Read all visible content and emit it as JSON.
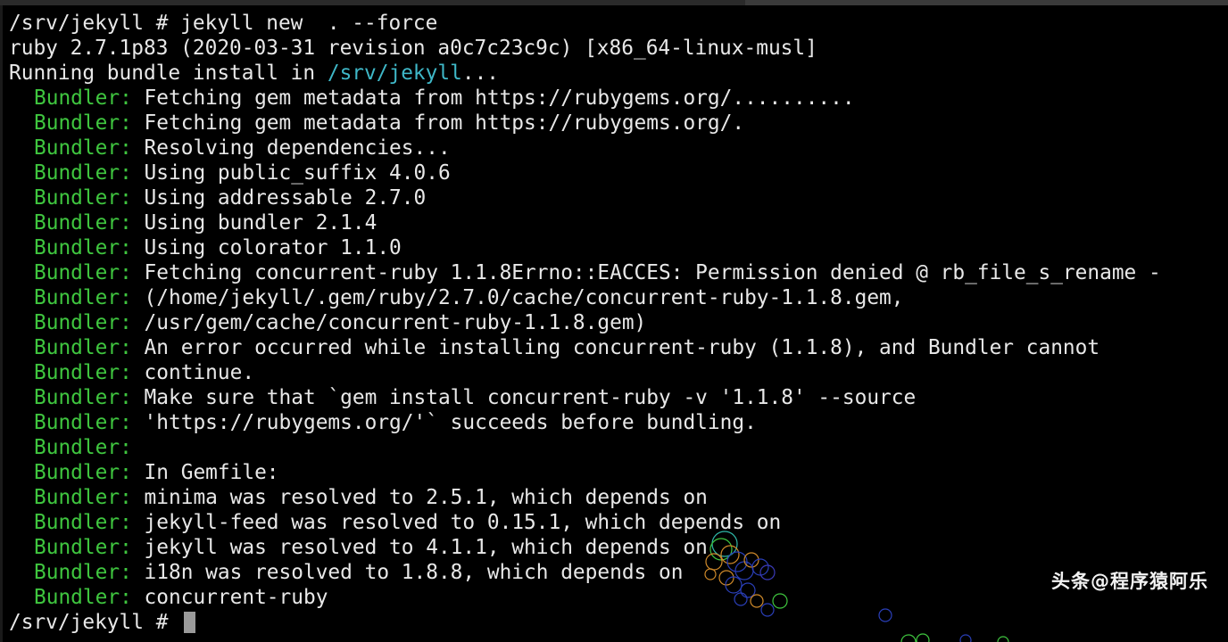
{
  "terminal": {
    "bundler_prefix": "Bundler:",
    "lines": [
      {
        "kind": "plain",
        "text": "/srv/jekyll # jekyll new  . --force"
      },
      {
        "kind": "plain",
        "text": "ruby 2.7.1p83 (2020-03-31 revision a0c7c23c9c) [x86_64-linux-musl]"
      },
      {
        "kind": "running",
        "before": "Running bundle install in ",
        "path": "/srv/jekyll",
        "after": "..."
      },
      {
        "kind": "bundler",
        "text": "Fetching gem metadata from https://rubygems.org/.........."
      },
      {
        "kind": "bundler",
        "text": "Fetching gem metadata from https://rubygems.org/."
      },
      {
        "kind": "bundler",
        "text": "Resolving dependencies..."
      },
      {
        "kind": "bundler",
        "text": "Using public_suffix 4.0.6"
      },
      {
        "kind": "bundler",
        "text": "Using addressable 2.7.0"
      },
      {
        "kind": "bundler",
        "text": "Using bundler 2.1.4"
      },
      {
        "kind": "bundler",
        "text": "Using colorator 1.1.0"
      },
      {
        "kind": "bundler",
        "text": "Fetching concurrent-ruby 1.1.8Errno::EACCES: Permission denied @ rb_file_s_rename -"
      },
      {
        "kind": "bundler",
        "text": "(/home/jekyll/.gem/ruby/2.7.0/cache/concurrent-ruby-1.1.8.gem,"
      },
      {
        "kind": "bundler",
        "text": "/usr/gem/cache/concurrent-ruby-1.1.8.gem)"
      },
      {
        "kind": "bundler",
        "text": "An error occurred while installing concurrent-ruby (1.1.8), and Bundler cannot"
      },
      {
        "kind": "bundler",
        "text": "continue."
      },
      {
        "kind": "bundler",
        "text": "Make sure that `gem install concurrent-ruby -v '1.1.8' --source"
      },
      {
        "kind": "bundler",
        "text": "'https://rubygems.org/'` succeeds before bundling."
      },
      {
        "kind": "bundler",
        "text": ""
      },
      {
        "kind": "bundler",
        "text": "In Gemfile:"
      },
      {
        "kind": "bundler",
        "text": "minima was resolved to 2.5.1, which depends on"
      },
      {
        "kind": "bundler",
        "text": "jekyll-feed was resolved to 0.15.1, which depends on"
      },
      {
        "kind": "bundler",
        "text": "jekyll was resolved to 4.1.1, which depends on"
      },
      {
        "kind": "bundler",
        "text": "i18n was resolved to 1.8.8, which depends on"
      },
      {
        "kind": "bundler",
        "text": "concurrent-ruby"
      },
      {
        "kind": "prompt",
        "text": "/srv/jekyll # "
      }
    ]
  },
  "watermark": {
    "text": "头条@程序猿阿乐"
  },
  "colors": {
    "background": "#000000",
    "foreground": "#e8e8e8",
    "bundler_green": "#3fc63f",
    "path_cyan": "#3fb8c8",
    "cursor": "#9a9a9a"
  }
}
